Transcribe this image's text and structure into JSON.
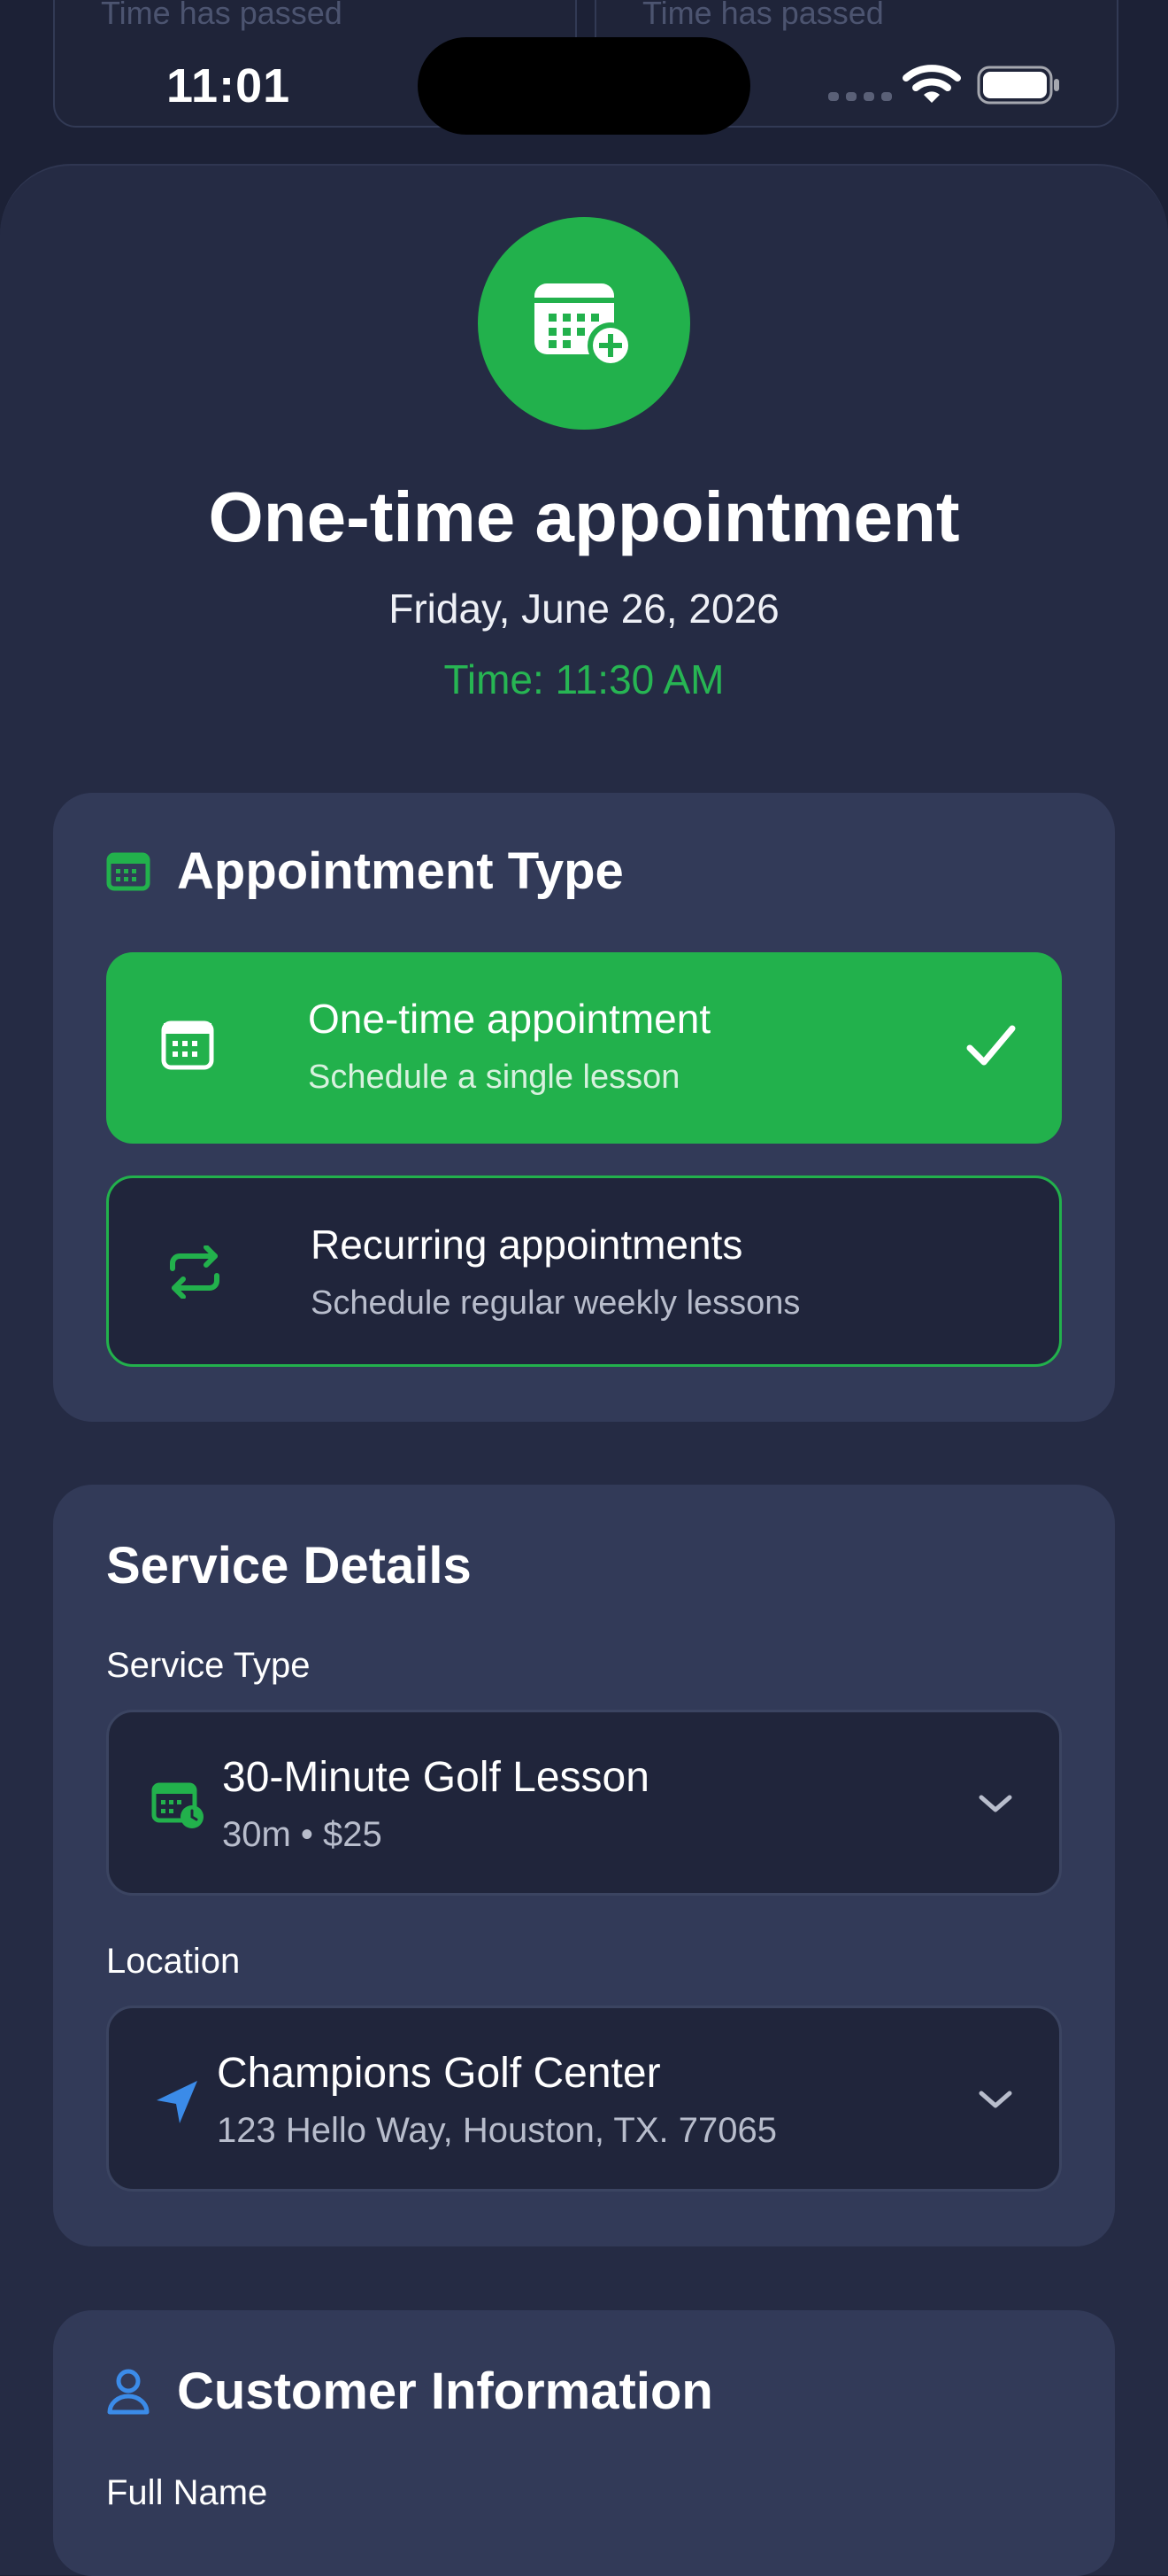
{
  "background": {
    "left_card_text": "Time has passed",
    "right_card_text": "Time has passed"
  },
  "status_bar": {
    "time": "11:01"
  },
  "header": {
    "title": "One-time appointment",
    "date": "Friday, June 26, 2026",
    "time": "Time: 11:30 AM"
  },
  "appointment_type": {
    "title": "Appointment Type",
    "options": [
      {
        "title": "One-time appointment",
        "subtitle": "Schedule a single lesson",
        "selected": true
      },
      {
        "title": "Recurring appointments",
        "subtitle": "Schedule regular weekly lessons",
        "selected": false
      }
    ]
  },
  "service_details": {
    "title": "Service Details",
    "service_type_label": "Service Type",
    "service": {
      "name": "30-Minute Golf Lesson",
      "details": "30m • $25"
    },
    "location_label": "Location",
    "location": {
      "name": "Champions Golf Center",
      "address": "123 Hello Way, Houston, TX. 77065"
    }
  },
  "customer_information": {
    "title": "Customer Information",
    "full_name_label": "Full Name"
  },
  "colors": {
    "accent_green": "#22b14c",
    "background": "#1c2136",
    "sheet": "#252b44",
    "card": "#323a58",
    "field": "#20253b",
    "location_blue": "#3b8be8"
  }
}
